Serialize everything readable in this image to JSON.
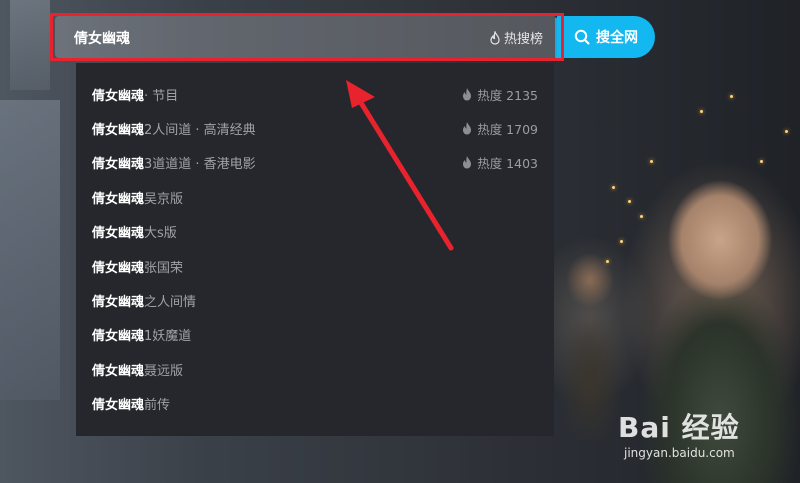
{
  "search": {
    "query": "倩女幽魂",
    "hot_rank_label": "热搜榜",
    "button_label": "搜全网"
  },
  "suggestions": [
    {
      "keyword": "倩女幽魂",
      "suffix": " · 节目",
      "heat": "热度 2135"
    },
    {
      "keyword": "倩女幽魂",
      "suffix": "2人间道 · 高清经典",
      "heat": "热度 1709"
    },
    {
      "keyword": "倩女幽魂",
      "suffix": "3道道道 · 香港电影",
      "heat": "热度 1403"
    },
    {
      "keyword": "倩女幽魂",
      "suffix": "吴京版"
    },
    {
      "keyword": "倩女幽魂",
      "suffix": "大s版"
    },
    {
      "keyword": "倩女幽魂",
      "suffix": "张国荣"
    },
    {
      "keyword": "倩女幽魂",
      "suffix": "之人间情"
    },
    {
      "keyword": "倩女幽魂",
      "suffix": "1妖魔道"
    },
    {
      "keyword": "倩女幽魂",
      "suffix": "聂远版"
    },
    {
      "keyword": "倩女幽魂",
      "suffix": "前传"
    }
  ],
  "watermark": {
    "logo": "Bai 经验",
    "url": "jingyan.baidu.com"
  },
  "colors": {
    "accent": "#14b8f0",
    "annotation_red": "#e8232d",
    "dropdown_bg": "#26272c"
  },
  "icons": {
    "hot": "flame-icon",
    "search": "search-icon"
  }
}
